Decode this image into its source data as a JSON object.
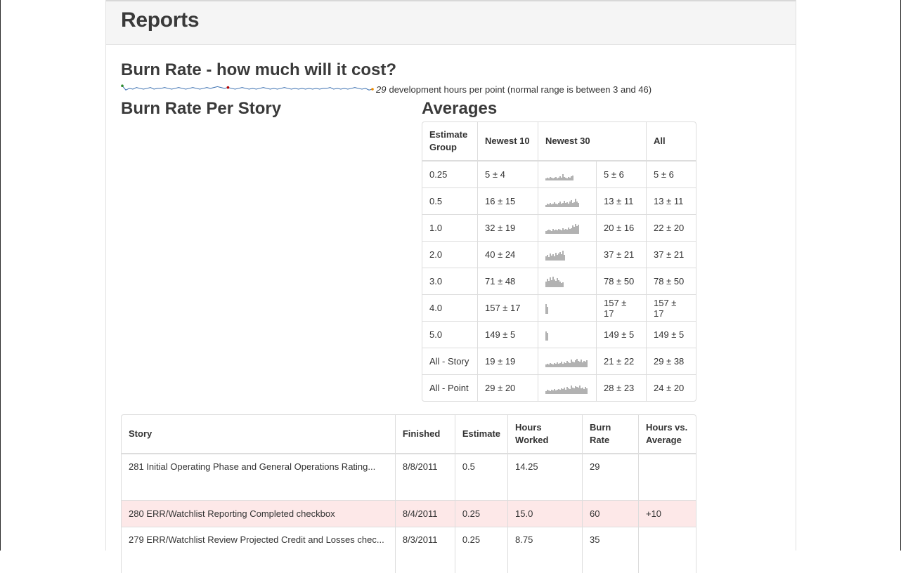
{
  "page": {
    "title": "Reports",
    "burn_heading": "Burn Rate - how much will it cost?",
    "burn_value": "29",
    "burn_text": "development hours per point (normal range is between 3 and 46)",
    "per_story_heading": "Burn Rate Per Story",
    "averages_heading": "Averages"
  },
  "colors": {
    "sparkline": "#3a6fb0",
    "spark_start": "#2e8b2e",
    "spark_min": "#b30000",
    "spark_end": "#f08c00",
    "row_highlight": "#fde8e8"
  },
  "averages": {
    "headers": [
      "Estimate Group",
      "Newest 10",
      "Newest 30",
      "All"
    ],
    "rows": [
      {
        "group": "0.25",
        "newest10": "5 ± 4",
        "newest30": "5 ± 6",
        "all": "5 ± 6",
        "spark": [
          3,
          4,
          3,
          5,
          4,
          3,
          4,
          5,
          3,
          4,
          6,
          4,
          9,
          5,
          4,
          3,
          5,
          4,
          6,
          7
        ]
      },
      {
        "group": "0.5",
        "newest10": "16 ± 15",
        "newest30": "13 ± 11",
        "all": "13 ± 11",
        "spark": [
          3,
          5,
          4,
          6,
          4,
          5,
          7,
          5,
          4,
          6,
          8,
          5,
          6,
          9,
          6,
          7,
          5,
          8,
          10,
          6,
          7,
          12,
          8,
          6
        ]
      },
      {
        "group": "1.0",
        "newest10": "32 ± 19",
        "newest30": "20 ± 16",
        "all": "22 ± 20",
        "spark": [
          4,
          5,
          6,
          5,
          4,
          7,
          5,
          6,
          5,
          7,
          6,
          5,
          8,
          6,
          7,
          6,
          9,
          7,
          8,
          12,
          10,
          14,
          11,
          13
        ]
      },
      {
        "group": "2.0",
        "newest10": "40 ± 24",
        "newest30": "37 ± 21",
        "all": "37 ± 21",
        "spark": [
          6,
          8,
          5,
          10,
          7,
          9,
          6,
          11,
          8,
          10,
          12,
          9,
          14,
          8
        ]
      },
      {
        "group": "3.0",
        "newest10": "71 ± 48",
        "newest30": "78 ± 50",
        "all": "78 ± 50",
        "spark": [
          8,
          12,
          9,
          14,
          10,
          16,
          11,
          9,
          13,
          10,
          8,
          6,
          7
        ]
      },
      {
        "group": "4.0",
        "newest10": "157 ± 17",
        "newest30": "157 ± 17",
        "all": "157 ± 17",
        "spark": [
          14,
          10
        ]
      },
      {
        "group": "5.0",
        "newest10": "149 ± 5",
        "newest30": "149 ± 5",
        "all": "149 ± 5",
        "spark": [
          13,
          11
        ]
      },
      {
        "group": "All - Story",
        "newest10": "19 ± 19",
        "newest30": "21 ± 22",
        "all": "29 ± 38",
        "spark": [
          4,
          5,
          4,
          6,
          5,
          4,
          6,
          5,
          7,
          5,
          6,
          8,
          5,
          7,
          6,
          9,
          7,
          6,
          11,
          8,
          7,
          10,
          12,
          9,
          8,
          11,
          7,
          9,
          8,
          10
        ]
      },
      {
        "group": "All - Point",
        "newest10": "29 ± 20",
        "newest30": "28 ± 23",
        "all": "24 ± 20",
        "spark": [
          4,
          6,
          5,
          4,
          6,
          5,
          7,
          5,
          6,
          7,
          6,
          8,
          7,
          9,
          6,
          10,
          8,
          7,
          12,
          9,
          8,
          11,
          10,
          9,
          12,
          8,
          9,
          7,
          10,
          8
        ]
      }
    ]
  },
  "stories": {
    "headers": [
      "Story",
      "Finished",
      "Estimate",
      "Hours Worked",
      "Burn Rate",
      "Hours vs. Average"
    ],
    "rows": [
      {
        "story": "281 Initial Operating Phase and General Operations Rating...",
        "finished": "8/8/2011",
        "estimate": "0.5",
        "hours": "14.25",
        "burn": "29",
        "vs": "",
        "highlight": false
      },
      {
        "story": "280 ERR/Watchlist Reporting Completed checkbox",
        "finished": "8/4/2011",
        "estimate": "0.25",
        "hours": "15.0",
        "burn": "60",
        "vs": "+10",
        "highlight": true
      },
      {
        "story": "279 ERR/Watchlist Review Projected Credit and Losses chec...",
        "finished": "8/3/2011",
        "estimate": "0.25",
        "hours": "8.75",
        "burn": "35",
        "vs": "",
        "highlight": false
      }
    ]
  },
  "burn_sparkline": [
    9,
    4,
    6,
    5,
    7,
    6,
    5,
    6,
    7,
    5,
    6,
    6,
    7,
    6,
    5,
    6,
    7,
    6,
    5,
    6,
    7,
    6,
    5,
    6,
    7,
    6,
    7,
    8,
    7,
    6,
    7,
    6,
    5,
    6,
    7,
    6,
    5,
    6,
    5,
    6,
    7,
    6,
    5,
    6,
    5,
    6,
    7,
    6,
    5,
    6,
    5,
    6,
    5,
    6,
    5,
    6,
    5,
    6,
    6,
    7,
    5,
    6,
    5,
    6,
    5,
    6,
    7,
    6,
    5,
    6,
    4,
    5
  ]
}
